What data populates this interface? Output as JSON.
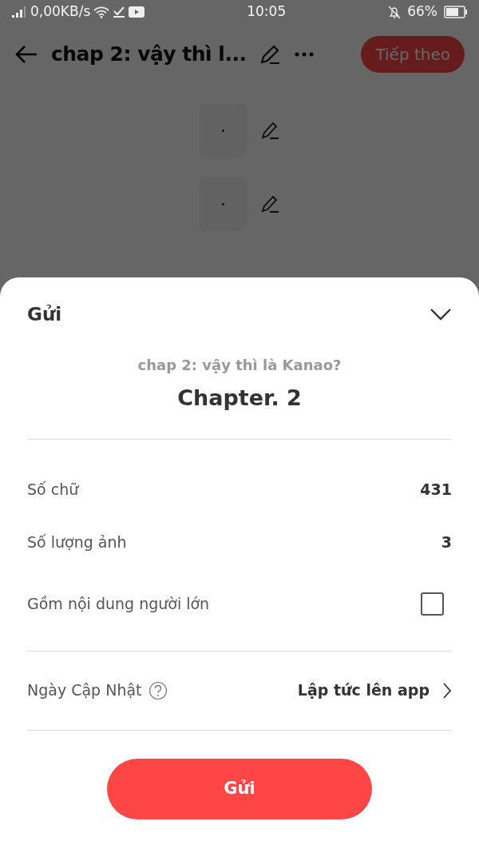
{
  "status_bar": {
    "network_speed": "0,00KB/s",
    "time": "10:05",
    "battery": "66%"
  },
  "header": {
    "title": "chap 2: vậy thì l...",
    "next_button": "Tiếp theo"
  },
  "sheet": {
    "title": "Gửi",
    "subtitle": "chap 2: vậy thì là Kanao?",
    "heading": "Chapter. 2",
    "stats": [
      {
        "label": "Số chữ",
        "value": "431"
      },
      {
        "label": "Số lượng ảnh",
        "value": "3"
      }
    ],
    "adult_content": {
      "label": "Gồm nội dung người lớn",
      "checked": false
    },
    "update": {
      "label": "Ngày Cập Nhật",
      "value": "Lập tức lên app"
    },
    "submit_button": "Gửi"
  }
}
